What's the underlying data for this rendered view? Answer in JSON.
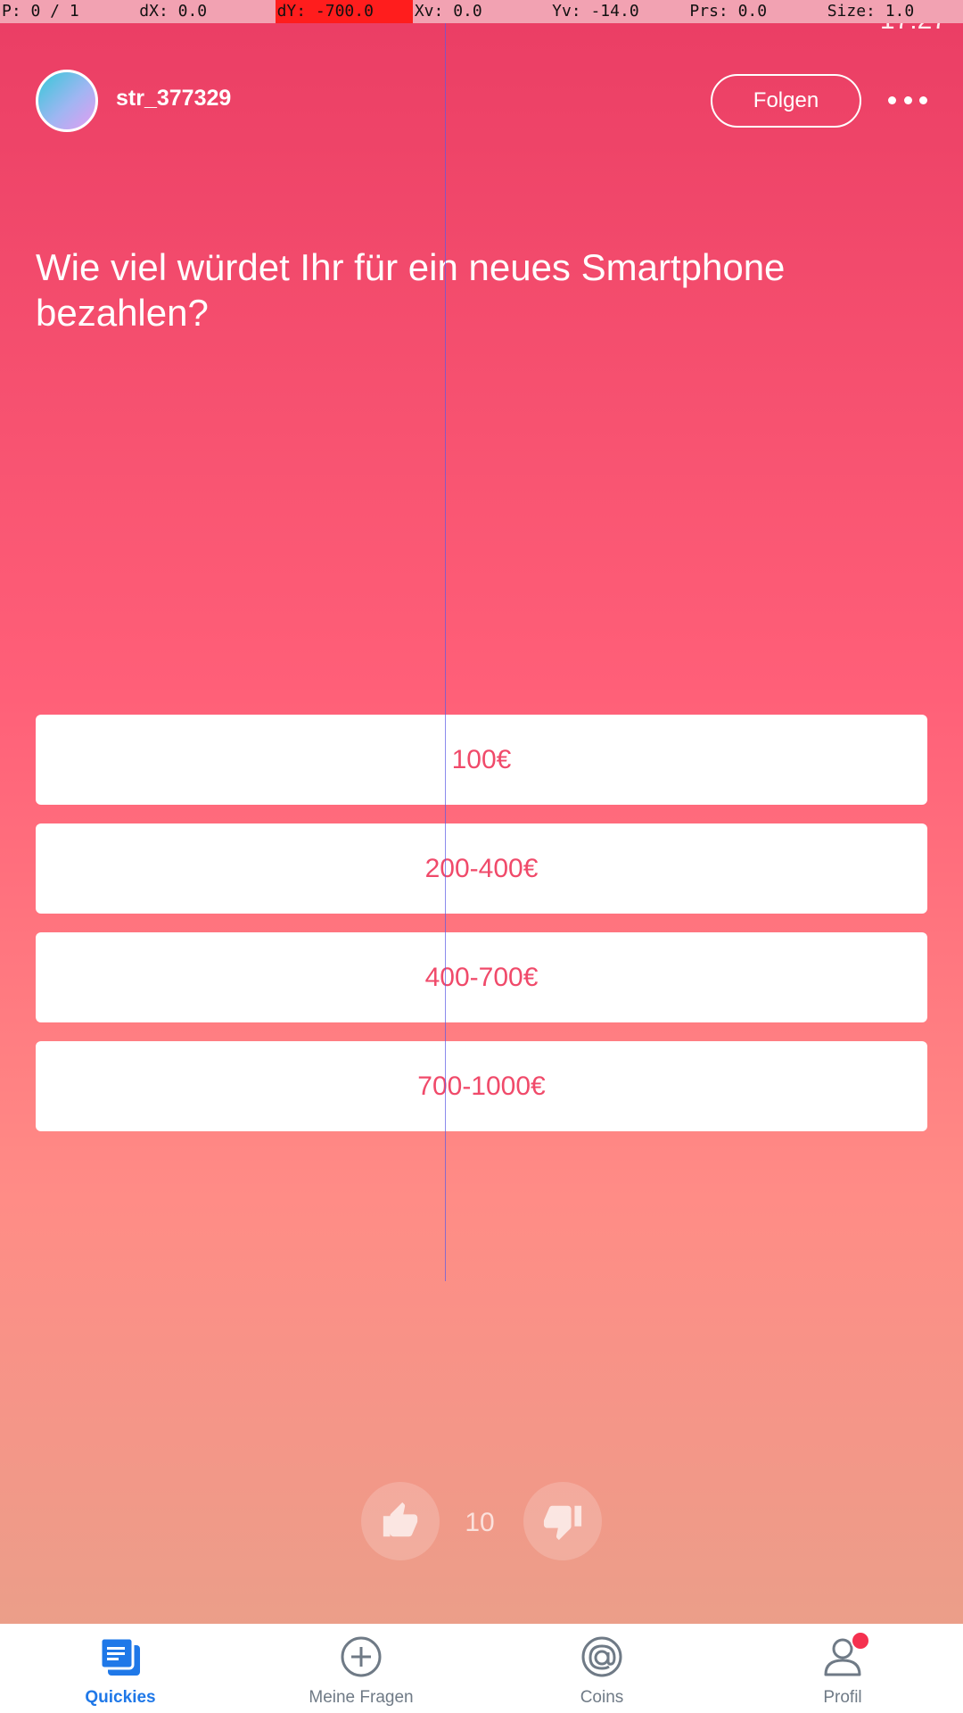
{
  "debug": {
    "pointer": "P: 0 / 1",
    "dx": "dX: 0.0",
    "dy": "dY: -700.0",
    "xv": "Xv: 0.0",
    "yv": "Yv: -14.0",
    "prs": "Prs: 0.0",
    "size": "Size: 1.0"
  },
  "status": {
    "time": "17:27"
  },
  "header": {
    "username": "str_377329",
    "follow_label": "Folgen"
  },
  "question": "Wie viel würdet Ihr für ein neues Smartphone bezahlen?",
  "answers": [
    "100€",
    "200-400€",
    "400-700€",
    "700-1000€"
  ],
  "votes": {
    "count": "10"
  },
  "nav": {
    "items": [
      {
        "label": "Quickies",
        "icon": "quickies-icon",
        "active": true
      },
      {
        "label": "Meine Fragen",
        "icon": "plus-circle-icon"
      },
      {
        "label": "Coins",
        "icon": "at-coin-icon"
      },
      {
        "label": "Profil",
        "icon": "profile-icon",
        "badge": true
      }
    ]
  },
  "colors": {
    "accent": "#f04a6a",
    "nav_active": "#1f78e8",
    "badge": "#f5314f"
  }
}
